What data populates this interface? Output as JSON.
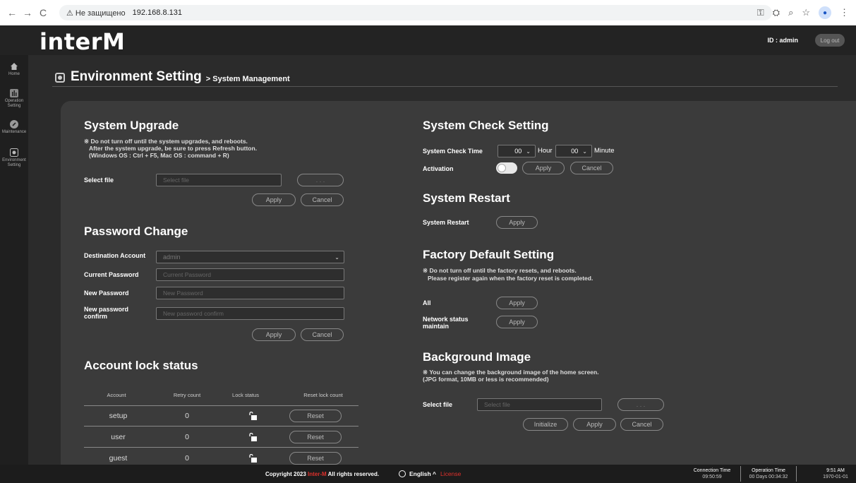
{
  "browser": {
    "back": "←",
    "forward": "→",
    "reload": "C",
    "security_warning": "⚠ Не защищено",
    "url": "192.168.8.131"
  },
  "header": {
    "logo": "interM",
    "user_id": "ID : admin",
    "logout_label": "Log out"
  },
  "sidebar": {
    "items": [
      {
        "label": "Home"
      },
      {
        "label": "Operation Setting"
      },
      {
        "label": "Maintenance"
      },
      {
        "label": "Environment Setting"
      }
    ]
  },
  "page": {
    "title": "Environment Setting",
    "subtitle": "> System Management"
  },
  "system_upgrade": {
    "title": "System Upgrade",
    "note_line1": "※ Do not turn off until the system upgrades, and reboots.",
    "note_line2": "After the system upgrade, be sure to press Refresh button.",
    "note_line3": "(Windows OS : Ctrl + F5, Mac OS : command + R)",
    "select_label": "Select file",
    "select_placeholder": "Select file",
    "browse_label": ". . .",
    "apply_label": "Apply",
    "cancel_label": "Cancel"
  },
  "password_change": {
    "title": "Password Change",
    "dest_label": "Destination Account",
    "dest_value": "admin",
    "current_label": "Current Password",
    "current_placeholder": "Current Password",
    "new_label": "New Password",
    "new_placeholder": "New Password",
    "confirm_label_line1": "New password",
    "confirm_label_line2": "confirm",
    "confirm_placeholder": "New password confirm",
    "apply_label": "Apply",
    "cancel_label": "Cancel"
  },
  "account_lock": {
    "title": "Account lock status",
    "headers": [
      "Account",
      "Retry count",
      "Lock status",
      "Reset lock count"
    ],
    "rows": [
      {
        "account": "setup",
        "retry": "0",
        "reset_label": "Reset"
      },
      {
        "account": "user",
        "retry": "0",
        "reset_label": "Reset"
      },
      {
        "account": "guest",
        "retry": "0",
        "reset_label": "Reset"
      }
    ]
  },
  "system_check": {
    "title": "System Check Setting",
    "time_label": "System Check Time",
    "hour_value": "00",
    "hour_unit": "Hour",
    "minute_value": "00",
    "minute_unit": "Minute",
    "activation_label": "Activation",
    "activation_on": false,
    "apply_label": "Apply",
    "cancel_label": "Cancel"
  },
  "system_restart": {
    "title": "System Restart",
    "label": "System Restart",
    "apply_label": "Apply"
  },
  "factory_default": {
    "title": "Factory Default Setting",
    "note_line1": "※ Do not turn off until the factory resets, and reboots.",
    "note_line2": "Please register again when the factory reset is completed.",
    "all_label": "All",
    "all_apply": "Apply",
    "network_label_line1": "Network status",
    "network_label_line2": "maintain",
    "network_apply": "Apply"
  },
  "background_image": {
    "title": "Background Image",
    "note_line1": "※ You can change the background image of the home screen.",
    "note_line2": "(JPG format, 10MB or less is recommended)",
    "select_label": "Select file",
    "select_placeholder": "Select file",
    "browse_label": ". . .",
    "initialize_label": "Initialize",
    "apply_label": "Apply",
    "cancel_label": "Cancel"
  },
  "footer": {
    "copyright_prefix": "Copyright 2023",
    "brand": "Inter-M",
    "copyright_suffix": "All rights reserved.",
    "language": "English ^",
    "license": "License",
    "connection_time_label": "Connection Time",
    "connection_time_value": "09:50:59",
    "operation_time_label": "Operation Time",
    "operation_time_value": "00 Days 00:34:32",
    "clock_time": "9:51 AM",
    "clock_date": "1970-01-01"
  },
  "colors": {
    "accent_red": "#e0312c",
    "panel_bg": "#3b3b3b",
    "page_bg": "#2b2b2b"
  }
}
